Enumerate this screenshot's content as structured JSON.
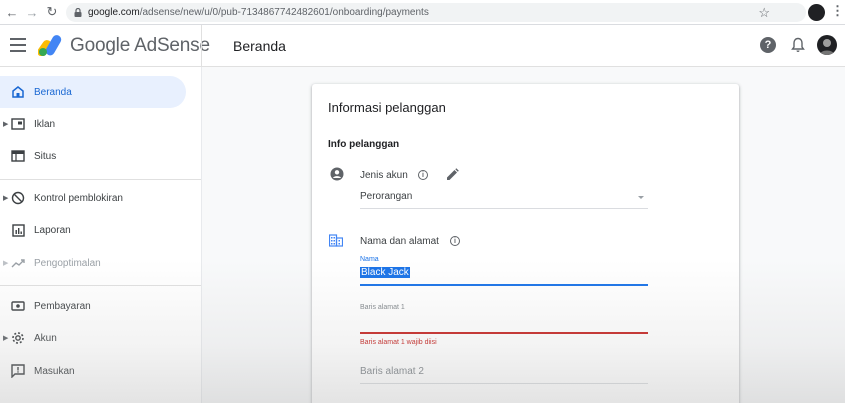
{
  "browser": {
    "url_host": "google.com",
    "url_path": "/adsense/new/u/0/pub-7134867742482601/onboarding/payments"
  },
  "header": {
    "brand": "Google AdSense",
    "page_title": "Beranda",
    "help_glyph": "?"
  },
  "sidebar": {
    "items": [
      {
        "label": "Beranda",
        "icon": "home-icon"
      },
      {
        "label": "Iklan",
        "icon": "ad-unit-icon"
      },
      {
        "label": "Situs",
        "icon": "web-icon"
      },
      {
        "label": "Kontrol pemblokiran",
        "icon": "block-icon"
      },
      {
        "label": "Laporan",
        "icon": "bar-chart-icon"
      },
      {
        "label": "Pengoptimalan",
        "icon": "trending-icon"
      },
      {
        "label": "Pembayaran",
        "icon": "payments-icon"
      },
      {
        "label": "Akun",
        "icon": "gear-icon"
      },
      {
        "label": "Masukan",
        "icon": "feedback-icon"
      }
    ]
  },
  "card": {
    "title": "Informasi pelanggan",
    "section_title": "Info pelanggan",
    "account_type": {
      "label": "Jenis akun",
      "value": "Perorangan"
    },
    "name_address": {
      "label": "Nama dan alamat",
      "name_label": "Nama",
      "name_value": "Black Jack",
      "address1_label": "Baris alamat 1",
      "address1_error": "Baris alamat 1 wajib diisi",
      "address2_placeholder": "Baris alamat 2"
    }
  },
  "colors": {
    "accent": "#1a73e8",
    "error": "#c5221f",
    "active_bg": "#e8f0fe"
  }
}
